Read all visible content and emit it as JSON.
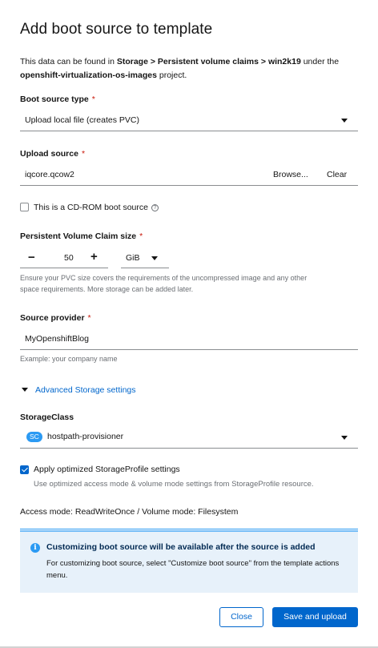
{
  "modal": {
    "title": "Add boot source to template",
    "description": {
      "prefix": "This data can be found in ",
      "path1": "Storage",
      "sep1": " > ",
      "path2": "Persistent volume claims",
      "sep2": " > ",
      "path3": "win2k19",
      "middle": " under the",
      "project": "openshift-virtualization-os-images",
      "suffix": " project."
    }
  },
  "boot_source_type": {
    "label": "Boot source type",
    "required": "*",
    "value": "Upload local file (creates PVC)"
  },
  "upload_source": {
    "label": "Upload source",
    "required": "*",
    "filename": "iqcore.qcow2",
    "browse_label": "Browse...",
    "clear_label": "Clear"
  },
  "cdrom": {
    "label": "This is a CD-ROM boot source",
    "help_icon": "?",
    "checked": false
  },
  "pvc_size": {
    "label": "Persistent Volume Claim size",
    "required": "*",
    "minus": "−",
    "value": "50",
    "plus": "+",
    "unit": "GiB",
    "helper_line1": "Ensure your PVC size covers the requirements of the uncompressed image and any other",
    "helper_line2": "space requirements. More storage can be added later."
  },
  "source_provider": {
    "label": "Source provider",
    "required": "*",
    "value": "MyOpenshiftBlog",
    "helper": "Example: your company name"
  },
  "advanced": {
    "label": "Advanced Storage settings"
  },
  "storage_class": {
    "label": "StorageClass",
    "badge": "SC",
    "value": "hostpath-provisioner"
  },
  "storage_profile": {
    "label": "Apply optimized StorageProfile settings",
    "checked": true,
    "helper": "Use optimized access mode & volume mode settings from StorageProfile resource."
  },
  "access_mode": {
    "text": "Access mode: ReadWriteOnce / Volume mode: Filesystem"
  },
  "alert": {
    "icon": "i",
    "title": "Customizing boot source will be available after the source is added",
    "body": "For customizing boot source, select \"Customize boot source\" from the template actions menu."
  },
  "footer": {
    "close_label": "Close",
    "submit_label": "Save and upload"
  },
  "colors": {
    "primary": "#0066cc",
    "required": "#c9190b",
    "info": "#2b9af3",
    "alert_bg": "#e7f1fa"
  }
}
